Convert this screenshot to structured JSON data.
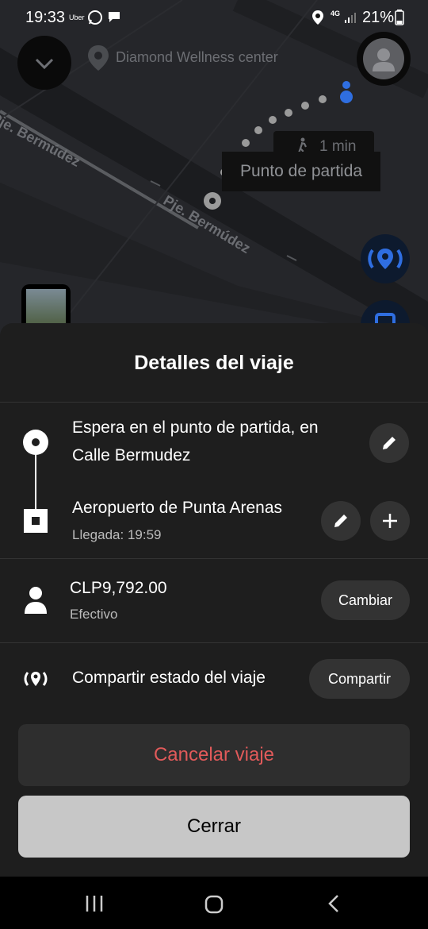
{
  "status_bar": {
    "time": "19:33",
    "uber_label": "Uber",
    "network": "4G",
    "battery": "21%"
  },
  "map": {
    "place_label": "Diamond Wellness center",
    "street_top": "Pje. Bermúdez",
    "street_middle": "Pje. Bermúdez",
    "walk_time": "1 min",
    "pickup_tooltip": "Punto de partida"
  },
  "sheet": {
    "title": "Detalles del viaje",
    "pickup_line1": "Espera en el punto de partida, en",
    "pickup_line2": "Calle Bermudez",
    "destination": "Aeropuerto de Punta Arenas",
    "arrival": "Llegada: 19:59",
    "price": "CLP9,792.00",
    "payment_method": "Efectivo",
    "change_button": "Cambiar",
    "share_text": "Compartir estado del viaje",
    "share_button": "Compartir",
    "cancel_button": "Cancelar viaje",
    "close_button": "Cerrar"
  },
  "colors": {
    "cancel_red": "#e15a5a",
    "accent_blue": "#2f6ee0",
    "close_bg": "#c7c7c7"
  }
}
